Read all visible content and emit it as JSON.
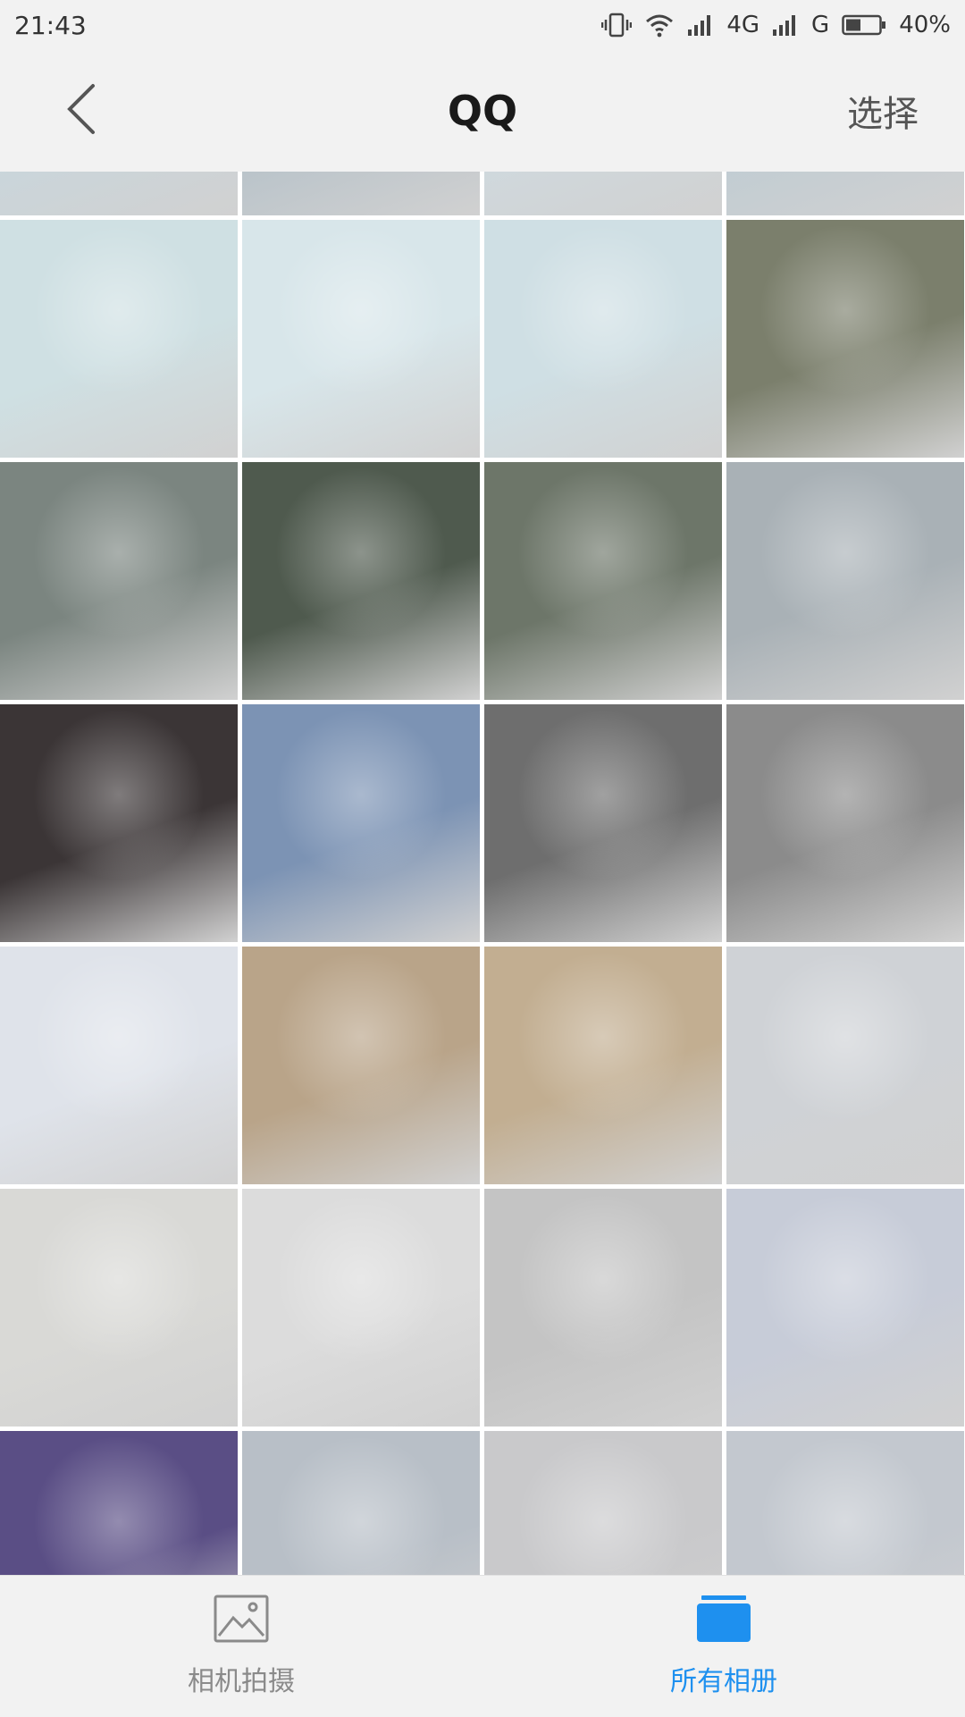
{
  "status_bar": {
    "time": "21:43",
    "network_1": "4G",
    "network_2": "G",
    "battery": "40%",
    "icons": [
      "vibrate-icon",
      "wifi-icon",
      "signal-icon",
      "signal-icon",
      "battery-icon"
    ]
  },
  "header": {
    "back_icon": "chevron-left-icon",
    "title": "QQ",
    "select_label": "选择"
  },
  "grid": {
    "columns": 4,
    "rows": [
      [
        "#c9d6dc",
        "#b7c2c9",
        "#cfd9de",
        "#c0ccd3"
      ],
      [
        "#cfe0e3",
        "#d8e6ea",
        "#cfdfe4",
        "#7b7f6c"
      ],
      [
        "#7b8580",
        "#4f5a4e",
        "#6d7669",
        "#a9b1b6"
      ],
      [
        "#3b3536",
        "#7c93b4",
        "#6e6e6e",
        "#8b8b8b"
      ],
      [
        "#dfe3ea",
        "#b9a489",
        "#c2ae91",
        "#cfd2d6"
      ],
      [
        "#d9d9d6",
        "#dcdcdc",
        "#c4c4c4",
        "#c7ccd8"
      ],
      [
        "#5a4e85",
        "#b8bfc7",
        "#c9c9cb",
        "#c3c8cf"
      ]
    ]
  },
  "bottom_bar": {
    "camera_tab": {
      "label": "相机拍摄",
      "icon": "image-icon"
    },
    "albums_tab": {
      "label": "所有相册",
      "icon": "folder-icon",
      "active_color": "#1e90ef"
    }
  }
}
